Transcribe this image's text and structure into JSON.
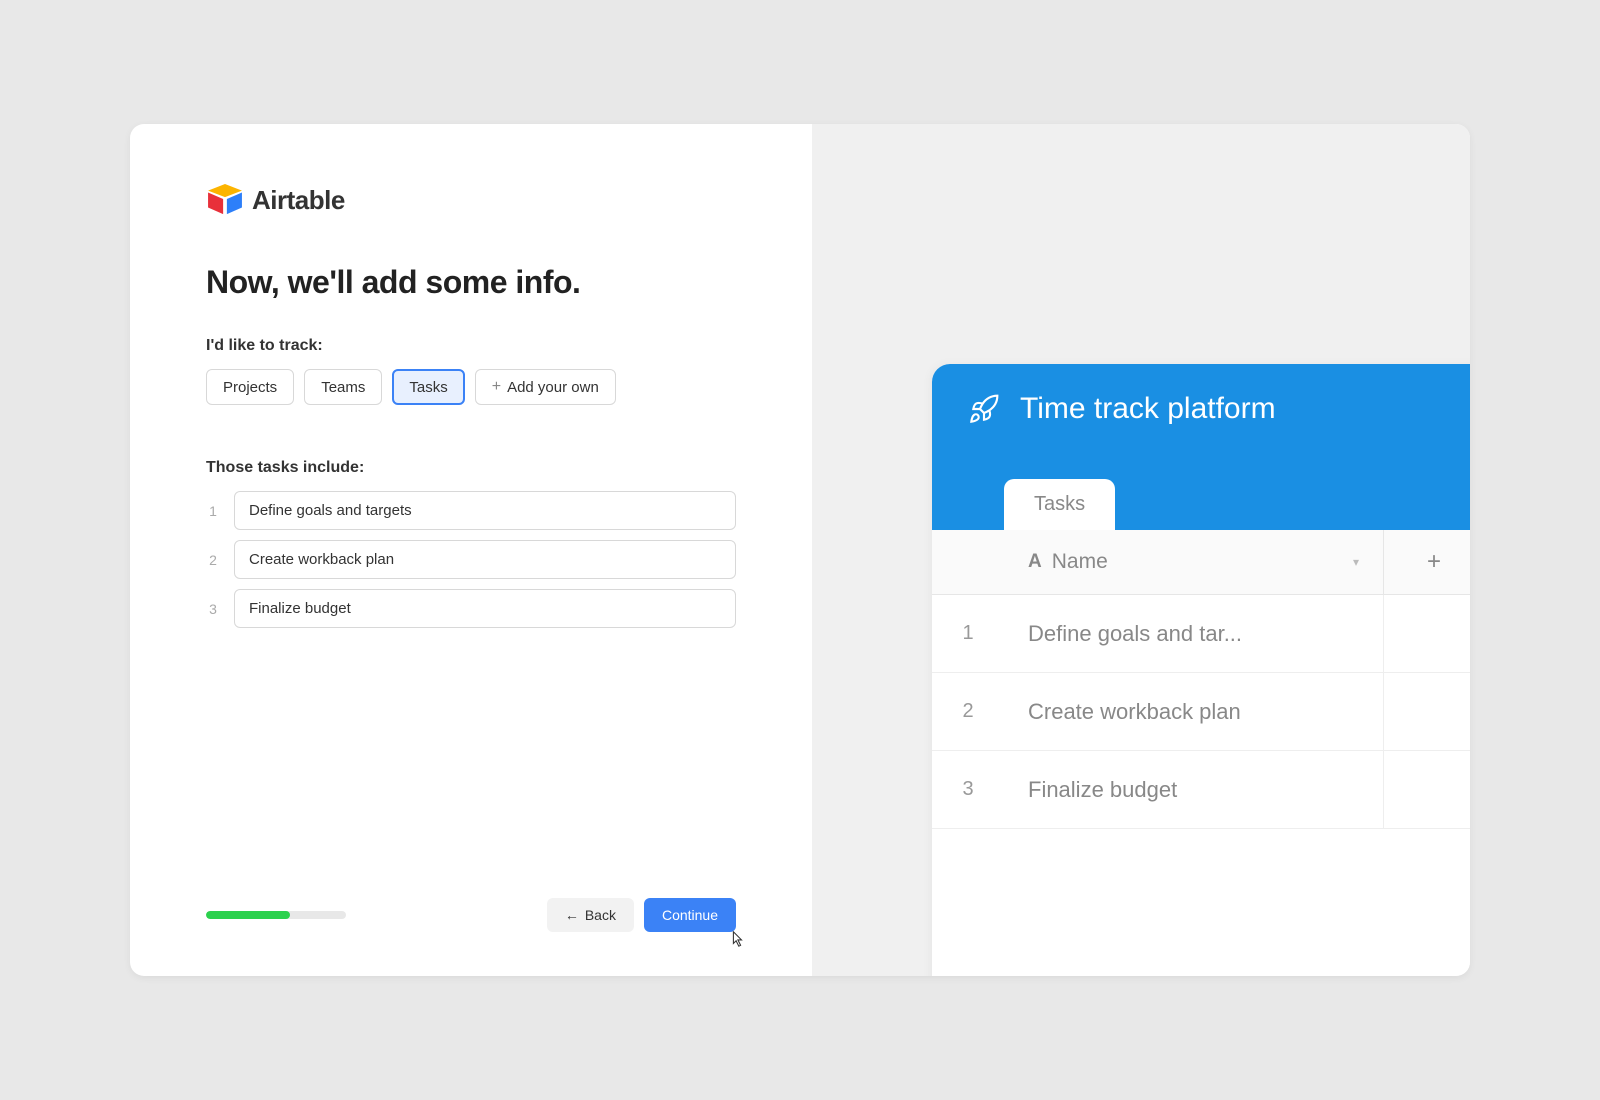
{
  "brand": {
    "name": "Airtable"
  },
  "wizard": {
    "heading": "Now, we'll add some info.",
    "track_label": "I'd like to track:",
    "chips": [
      {
        "label": "Projects",
        "selected": false
      },
      {
        "label": "Teams",
        "selected": false
      },
      {
        "label": "Tasks",
        "selected": true
      }
    ],
    "add_own_label": "Add your own",
    "include_label": "Those tasks include:",
    "items": [
      {
        "num": "1",
        "value": "Define goals and targets"
      },
      {
        "num": "2",
        "value": "Create workback plan"
      },
      {
        "num": "3",
        "value": "Finalize budget"
      }
    ],
    "back_label": "Back",
    "continue_label": "Continue",
    "progress_percent": 60
  },
  "preview": {
    "title": "Time track platform",
    "tab_label": "Tasks",
    "column_name": "Name",
    "rows": [
      {
        "num": "1",
        "name": "Define goals and tar..."
      },
      {
        "num": "2",
        "name": "Create workback plan"
      },
      {
        "num": "3",
        "name": "Finalize budget"
      }
    ]
  },
  "colors": {
    "primary_blue": "#1a8fe3",
    "button_blue": "#3b82f6",
    "progress_green": "#2bd14d"
  }
}
